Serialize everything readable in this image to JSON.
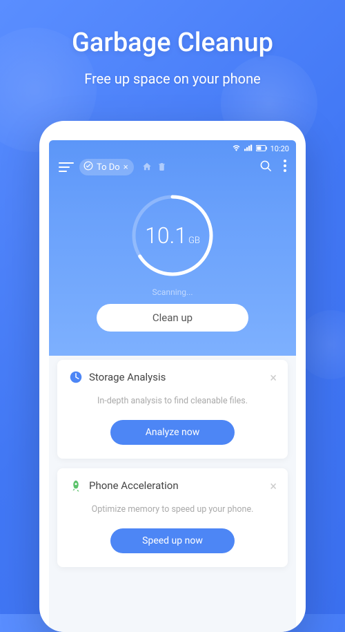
{
  "page": {
    "title": "Garbage Cleanup",
    "subtitle": "Free up space on your phone"
  },
  "statusbar": {
    "time": "10:20"
  },
  "toolbar": {
    "chip_label": "To Do"
  },
  "gauge": {
    "value": "10.1",
    "unit": "GB"
  },
  "scanning_label": "Scanning...",
  "cleanup_label": "Clean up",
  "cards": [
    {
      "title": "Storage Analysis",
      "desc": "In-depth analysis to find cleanable files.",
      "button": "Analyze now"
    },
    {
      "title": "Phone Acceleration",
      "desc": "Optimize memory to speed up your phone.",
      "button": "Speed up now"
    }
  ]
}
